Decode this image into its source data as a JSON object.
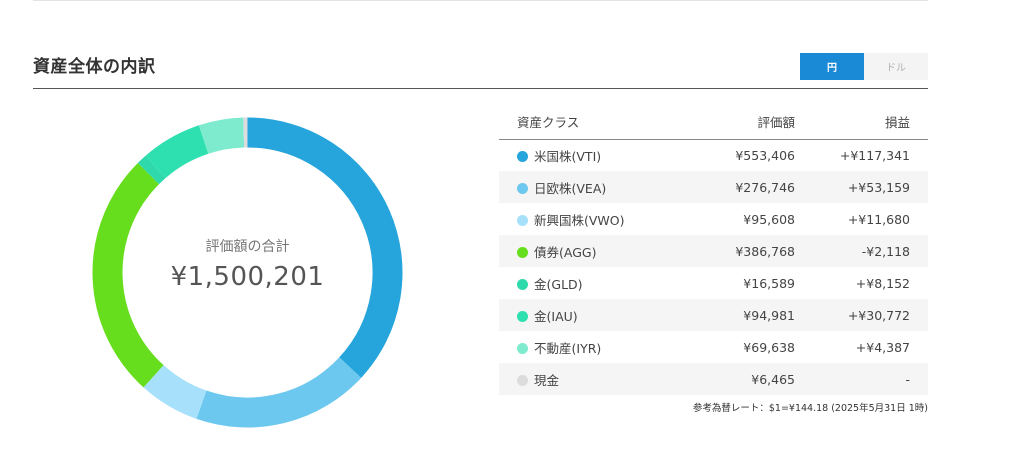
{
  "section": {
    "title": "資産全体の内訳"
  },
  "currency_toggle": {
    "options": [
      {
        "label": "円",
        "active": true
      },
      {
        "label": "ドル",
        "active": false
      }
    ]
  },
  "donut": {
    "center_label": "評価額の合計",
    "total": "¥1,500,201"
  },
  "table": {
    "headers": {
      "name": "資産クラス",
      "value": "評価額",
      "pl": "損益"
    },
    "rows": [
      {
        "name": "米国株(VTI)",
        "value": "¥553,406",
        "pl": "+¥117,341",
        "pl_sign": "pos",
        "amount": 553406,
        "color": "#26a4dc"
      },
      {
        "name": "日欧株(VEA)",
        "value": "¥276,746",
        "pl": "+¥53,159",
        "pl_sign": "pos",
        "amount": 276746,
        "color": "#6cc8ee"
      },
      {
        "name": "新興国株(VWO)",
        "value": "¥95,608",
        "pl": "+¥11,680",
        "pl_sign": "pos",
        "amount": 95608,
        "color": "#a7e0fb"
      },
      {
        "name": "債券(AGG)",
        "value": "¥386,768",
        "pl": "-¥2,118",
        "pl_sign": "neg",
        "amount": 386768,
        "color": "#66dd1d"
      },
      {
        "name": "金(GLD)",
        "value": "¥16,589",
        "pl": "+¥8,152",
        "pl_sign": "pos",
        "amount": 16589,
        "color": "#2ed9ab"
      },
      {
        "name": "金(IAU)",
        "value": "¥94,981",
        "pl": "+¥30,772",
        "pl_sign": "pos",
        "amount": 94981,
        "color": "#2ee0b0"
      },
      {
        "name": "不動産(IYR)",
        "value": "¥69,638",
        "pl": "+¥4,387",
        "pl_sign": "pos",
        "amount": 69638,
        "color": "#7eebcf"
      },
      {
        "name": "現金",
        "value": "¥6,465",
        "pl": "-",
        "pl_sign": "neutral",
        "amount": 6465,
        "color": "#dcdcdc"
      }
    ]
  },
  "fx_note": "参考為替レート：$1=¥144.18 (2025年5月31日 1時)"
}
